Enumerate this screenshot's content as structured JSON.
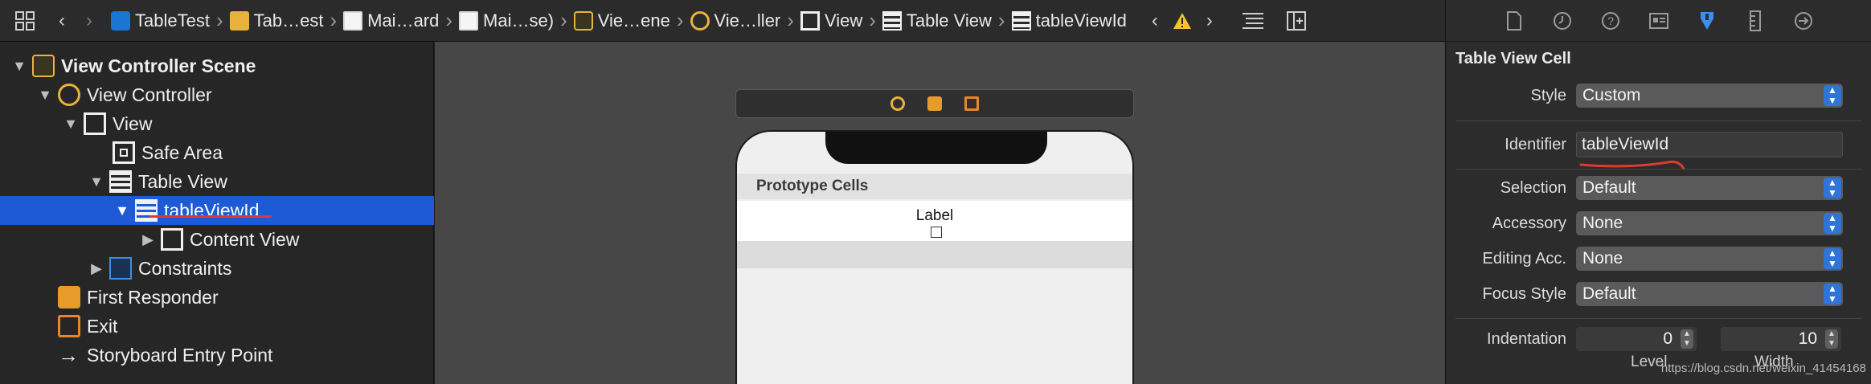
{
  "jumpbar": {
    "crumbs": [
      {
        "label": "TableTest",
        "icon": "xcode-project-icon"
      },
      {
        "label": "Tab…est",
        "icon": "folder-icon"
      },
      {
        "label": "Mai…ard",
        "icon": "storyboard-file-icon"
      },
      {
        "label": "Mai…se)",
        "icon": "storyboard-file-icon"
      },
      {
        "label": "Vie…ene",
        "icon": "scene-icon"
      },
      {
        "label": "Vie…ller",
        "icon": "view-controller-icon"
      },
      {
        "label": "View",
        "icon": "view-icon"
      },
      {
        "label": "Table View",
        "icon": "table-view-icon"
      },
      {
        "label": "tableViewId",
        "icon": "table-view-cell-icon"
      }
    ]
  },
  "outline": {
    "rows": [
      {
        "label": "View Controller Scene"
      },
      {
        "label": "View Controller"
      },
      {
        "label": "View"
      },
      {
        "label": "Safe Area"
      },
      {
        "label": "Table View"
      },
      {
        "label": "tableViewId"
      },
      {
        "label": "Content View"
      },
      {
        "label": "Constraints"
      },
      {
        "label": "First Responder"
      },
      {
        "label": "Exit"
      },
      {
        "label": "Storyboard Entry Point"
      }
    ]
  },
  "canvas": {
    "prototype_header": "Prototype Cells",
    "cell_label": "Label"
  },
  "inspector": {
    "section_title": "Table View Cell",
    "style": {
      "label": "Style",
      "value": "Custom"
    },
    "identifier": {
      "label": "Identifier",
      "value": "tableViewId"
    },
    "selection": {
      "label": "Selection",
      "value": "Default"
    },
    "accessory": {
      "label": "Accessory",
      "value": "None"
    },
    "editing_accessory": {
      "label": "Editing Acc.",
      "value": "None"
    },
    "focus_style": {
      "label": "Focus Style",
      "value": "Default"
    },
    "indentation": {
      "label": "Indentation",
      "level_value": "0",
      "width_value": "10",
      "level_label": "Level",
      "width_label": "Width"
    }
  },
  "watermark": "https://blog.csdn.net/weixin_41454168",
  "colors": {
    "selection": "#1e5ad6",
    "accent": "#3d8ef2",
    "annotation_red": "#e03a2e"
  }
}
